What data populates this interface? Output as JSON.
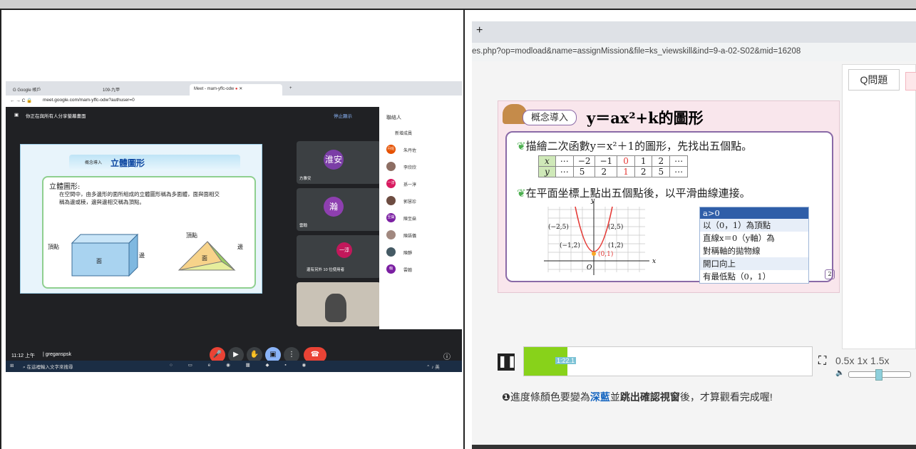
{
  "left": {
    "tabs": [
      "G Google 帳戶",
      "109-九甲",
      "Meet - mam-yffc-odw"
    ],
    "address": "meet.google.com/mam-yffc-odw?authuser=0",
    "presenting_text": "你正在與所有人分享螢幕畫面",
    "stop_presenting": "停止顯示",
    "slide": {
      "tag": "概念導入",
      "title": "立體圖形",
      "heading": "立體圖形:",
      "text": "在空間中，由多邊形的面所組成的立體圖形稱為多面體，面與面相交稱為邊或稜，邊與邊相交稱為頂點。",
      "labels": [
        "頂點",
        "面",
        "邊",
        "頂點",
        "面",
        "邊"
      ]
    },
    "tiles": [
      {
        "name": "方雅安",
        "avatar": "淮安",
        "color": "#7b3ea6"
      },
      {
        "name": "雲翰",
        "avatar": "瀚",
        "color": "#8e3fb0"
      },
      {
        "name": "還有另外 10 位使用者",
        "avatar": "一淳",
        "color": "#c2185b"
      }
    ],
    "sidebar": {
      "title": "聯絡人",
      "add": "新增成員",
      "people": [
        {
          "name": "朱丹佐",
          "badge": "丹佐",
          "color": "#e65100"
        },
        {
          "name": "李欣欣",
          "badge": "",
          "color": "#8d6e63"
        },
        {
          "name": "孫一淳",
          "badge": "一淳",
          "color": "#d81b60"
        },
        {
          "name": "郭慧珍",
          "badge": "",
          "color": "#6d4c41"
        },
        {
          "name": "陳至燊",
          "badge": "至燊",
          "color": "#7b1fa2"
        },
        {
          "name": "陳語儀",
          "badge": "",
          "color": "#a1887f"
        },
        {
          "name": "陳靜",
          "badge": "",
          "color": "#455a64"
        },
        {
          "name": "雲翰",
          "badge": "翰",
          "color": "#7b1fa2"
        }
      ]
    },
    "bottom": {
      "time": "11:12 上午",
      "user": "greganspsk"
    },
    "taskbar": {
      "search": "在這裡輸入文字來搜尋"
    }
  },
  "right": {
    "address": "es.php?op=modload&name=assignMission&file=ks_viewskill&ind=9-a-02-S02&mid=16208",
    "question_btn": "Q問題",
    "lesson": {
      "tag": "概念導入",
      "title_main": "y＝ax²+k的圖形",
      "line1": "描繪二次函數y＝x²＋1的圖形，先找出五個點。",
      "table_x": [
        "x",
        "⋯",
        "−2",
        "−1",
        "0",
        "1",
        "2",
        "⋯"
      ],
      "table_y": [
        "y",
        "⋯",
        "5",
        "2",
        "1",
        "2",
        "5",
        "⋯"
      ],
      "line2": "在平面坐標上點出五個點後，以平滑曲線連接。",
      "info": [
        "a>0",
        "以（0，1）為頂點",
        "直線x＝0（y軸）為",
        "對稱軸的拋物線",
        "開口向上",
        "有最低點（0，1）"
      ],
      "points": [
        "(−2,5)",
        "(2,5)",
        "(−1,2)",
        "(1,2)",
        "(0,1)"
      ],
      "page": "2"
    },
    "player": {
      "time": "1:22.1",
      "progress": 0.15,
      "speeds": [
        "0.5x",
        "1x",
        "1.5x"
      ]
    },
    "note_prefix": "進度條顏色要變為",
    "note_bold1": "深藍",
    "note_mid": "並",
    "note_bold2": "跳出確認視窗",
    "note_suffix": "後，才算觀看完成喔!"
  }
}
